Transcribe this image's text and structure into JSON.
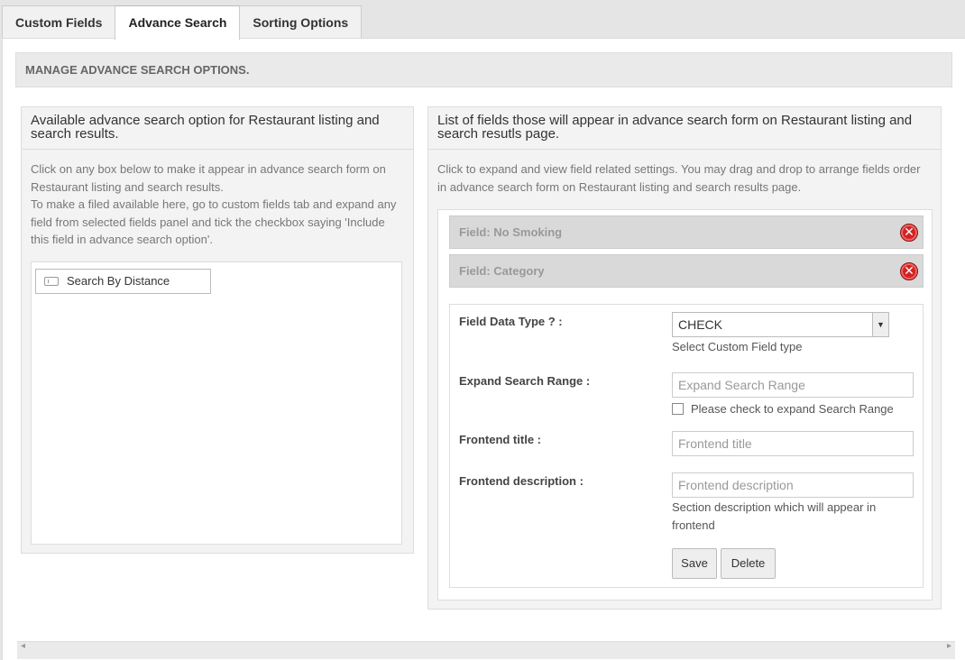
{
  "tabs": [
    {
      "label": "Custom Fields"
    },
    {
      "label": "Advance Search"
    },
    {
      "label": "Sorting Options"
    }
  ],
  "manage_header": "MANAGE ADVANCE SEARCH OPTIONS.",
  "left_panel": {
    "title": "Available advance search option for Restaurant listing and search results.",
    "desc1": "Click on any box below to make it appear in advance search form on Restaurant listing and search results.",
    "desc2": "To make a filed available here, go to custom fields tab and expand any field from selected fields panel and tick the checkbox saying 'Include this field in advance search option'.",
    "items": [
      {
        "label": "Search By Distance",
        "icon": "text-field-icon"
      }
    ]
  },
  "right_panel": {
    "title": "List of fields those will appear in advance search form on Restaurant listing and search resutls page.",
    "desc": "Click to expand and view field related settings. You may drag and drop to arrange fields order in advance search form on Restaurant listing and search results page.",
    "fields": [
      {
        "label": "Field: No Smoking"
      },
      {
        "label": "Field: Category"
      }
    ],
    "remove_glyph": "✕",
    "settings": {
      "data_type_label": "Field Data Type ? :",
      "data_type_value": "CHECK",
      "data_type_hint": "Select Custom Field type",
      "expand_label": "Expand Search Range :",
      "expand_placeholder": "Expand Search Range",
      "expand_check_label": "Please check to expand Search Range",
      "title_label": "Frontend title :",
      "title_placeholder": "Frontend  title",
      "desc_label": "Frontend description :",
      "desc_placeholder": "Frontend description",
      "desc_hint": "Section description which will appear in frontend",
      "save_label": "Save",
      "delete_label": "Delete"
    }
  },
  "colors": {
    "remove": "#d42222",
    "bar": "#d9d9d9"
  }
}
